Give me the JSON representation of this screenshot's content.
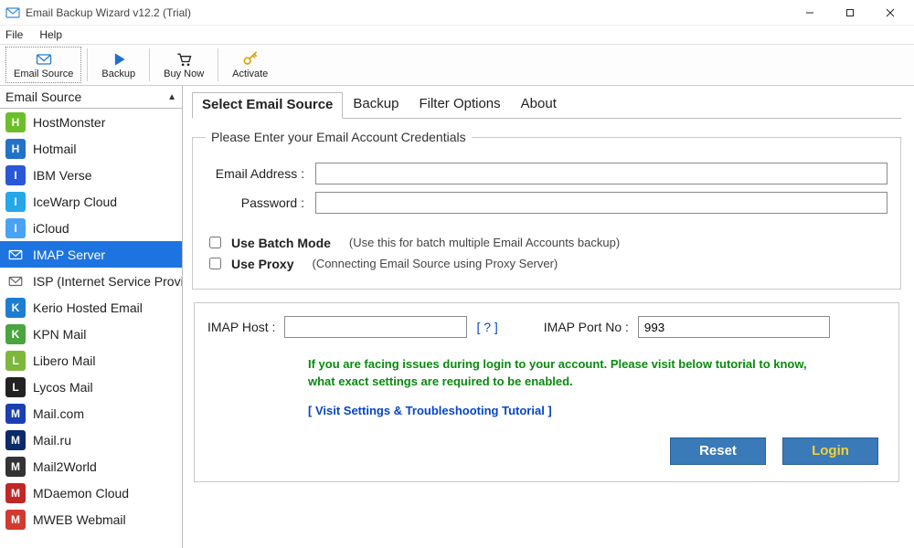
{
  "window": {
    "title": "Email Backup Wizard v12.2 (Trial)"
  },
  "menu": {
    "file": "File",
    "help": "Help"
  },
  "toolbar": {
    "email_source": "Email Source",
    "backup": "Backup",
    "buy_now": "Buy Now",
    "activate": "Activate"
  },
  "sidebar": {
    "header": "Email Source",
    "items": [
      {
        "label": "HostMonster",
        "color": "#6cbf2b"
      },
      {
        "label": "Hotmail",
        "color": "#2272c9"
      },
      {
        "label": "IBM Verse",
        "color": "#2a57d4"
      },
      {
        "label": "IceWarp Cloud",
        "color": "#25a7e8"
      },
      {
        "label": "iCloud",
        "color": "#4aa3f2"
      },
      {
        "label": "IMAP Server",
        "color": "#ffffff"
      },
      {
        "label": "ISP (Internet Service Provider)",
        "color": "#888888"
      },
      {
        "label": "Kerio Hosted Email",
        "color": "#1f7dd0"
      },
      {
        "label": "KPN Mail",
        "color": "#4aa53f"
      },
      {
        "label": "Libero Mail",
        "color": "#7db83c"
      },
      {
        "label": "Lycos Mail",
        "color": "#222222"
      },
      {
        "label": "Mail.com",
        "color": "#1a3fb0"
      },
      {
        "label": "Mail.ru",
        "color": "#0a2a6a"
      },
      {
        "label": "Mail2World",
        "color": "#333333"
      },
      {
        "label": "MDaemon Cloud",
        "color": "#c22727"
      },
      {
        "label": "MWEB Webmail",
        "color": "#d03a2f"
      }
    ],
    "selected_index": 5
  },
  "tabs": {
    "items": [
      "Select Email Source",
      "Backup",
      "Filter Options",
      "About"
    ],
    "active_index": 0
  },
  "credentials": {
    "legend": "Please Enter your Email Account Credentials",
    "email_label": "Email Address :",
    "email_value": "",
    "password_label": "Password :",
    "password_value": ""
  },
  "options": {
    "batch_label": "Use Batch Mode",
    "batch_hint": "(Use this for batch multiple Email Accounts backup)",
    "batch_checked": false,
    "proxy_label": "Use Proxy",
    "proxy_hint": "(Connecting Email Source using Proxy Server)",
    "proxy_checked": false
  },
  "imap": {
    "host_label": "IMAP Host :",
    "host_value": "",
    "help_link": "[ ? ]",
    "port_label": "IMAP Port No :",
    "port_value": "993"
  },
  "help": {
    "message_line1": "If you are facing issues during login to your account. Please visit below tutorial to know,",
    "message_line2": "what exact settings are required to be enabled.",
    "tutorial_link": "[ Visit Settings & Troubleshooting Tutorial ]"
  },
  "actions": {
    "reset": "Reset",
    "login": "Login"
  }
}
